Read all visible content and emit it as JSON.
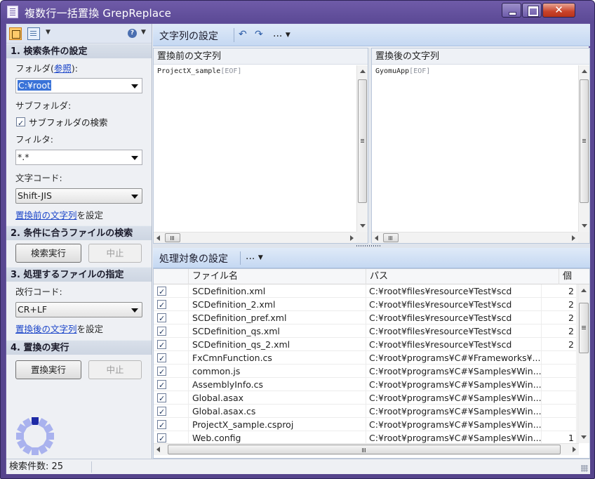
{
  "window": {
    "title": "複数行一括置換 GrepReplace"
  },
  "left": {
    "section1": "1. 検索条件の設定",
    "folder_label_prefix": "フォルダ(",
    "folder_link": "参照",
    "folder_label_suffix": "):",
    "folder_value": "C:¥root",
    "subfolder_label": "サブフォルダ:",
    "subfolder_check": "サブフォルダの検索",
    "filter_label": "フィルタ:",
    "filter_value": "*.*",
    "encoding_label": "文字コード:",
    "encoding_value": "Shift-JIS",
    "set_before_link": "置換前の文字列",
    "set_suffix": "を設定",
    "section2": "2. 条件に合うファイルの検索",
    "search_button": "検索実行",
    "stop_button": "中止",
    "section3": "3. 処理するファイルの指定",
    "newline_label": "改行コード:",
    "newline_value": "CR+LF",
    "set_after_link": "置換後の文字列",
    "section4": "4. 置換の実行",
    "replace_button": "置換実行",
    "stop_button2": "中止"
  },
  "editor": {
    "toolbar_title": "文字列の設定",
    "more": "...",
    "before_title": "置換前の文字列",
    "before_text": "ProjectX_sample",
    "after_title": "置換後の文字列",
    "after_text": "GyomuApp",
    "eof": "[EOF]"
  },
  "table": {
    "toolbar_title": "処理対象の設定",
    "more": "...",
    "headers": [
      "ファイル名",
      "パス",
      "個"
    ],
    "rows": [
      {
        "name": "SCDefinition.xml",
        "path": "C:¥root¥files¥resource¥Test¥scd",
        "count": "2"
      },
      {
        "name": "SCDefinition_2.xml",
        "path": "C:¥root¥files¥resource¥Test¥scd",
        "count": "2"
      },
      {
        "name": "SCDefinition_pref.xml",
        "path": "C:¥root¥files¥resource¥Test¥scd",
        "count": "2"
      },
      {
        "name": "SCDefinition_qs.xml",
        "path": "C:¥root¥files¥resource¥Test¥scd",
        "count": "2"
      },
      {
        "name": "SCDefinition_qs_2.xml",
        "path": "C:¥root¥files¥resource¥Test¥scd",
        "count": "2"
      },
      {
        "name": "FxCmnFunction.cs",
        "path": "C:¥root¥programs¥C#¥Frameworks¥...",
        "count": ""
      },
      {
        "name": "common.js",
        "path": "C:¥root¥programs¥C#¥Samples¥Win...",
        "count": ""
      },
      {
        "name": "AssemblyInfo.cs",
        "path": "C:¥root¥programs¥C#¥Samples¥Win...",
        "count": ""
      },
      {
        "name": "Global.asax",
        "path": "C:¥root¥programs¥C#¥Samples¥Win...",
        "count": ""
      },
      {
        "name": "Global.asax.cs",
        "path": "C:¥root¥programs¥C#¥Samples¥Win...",
        "count": ""
      },
      {
        "name": "ProjectX_sample.csproj",
        "path": "C:¥root¥programs¥C#¥Samples¥Win...",
        "count": ""
      },
      {
        "name": "Web.config",
        "path": "C:¥root¥programs¥C#¥Samples¥Win...",
        "count": "1"
      }
    ]
  },
  "status": {
    "text": "検索件数: 25"
  }
}
